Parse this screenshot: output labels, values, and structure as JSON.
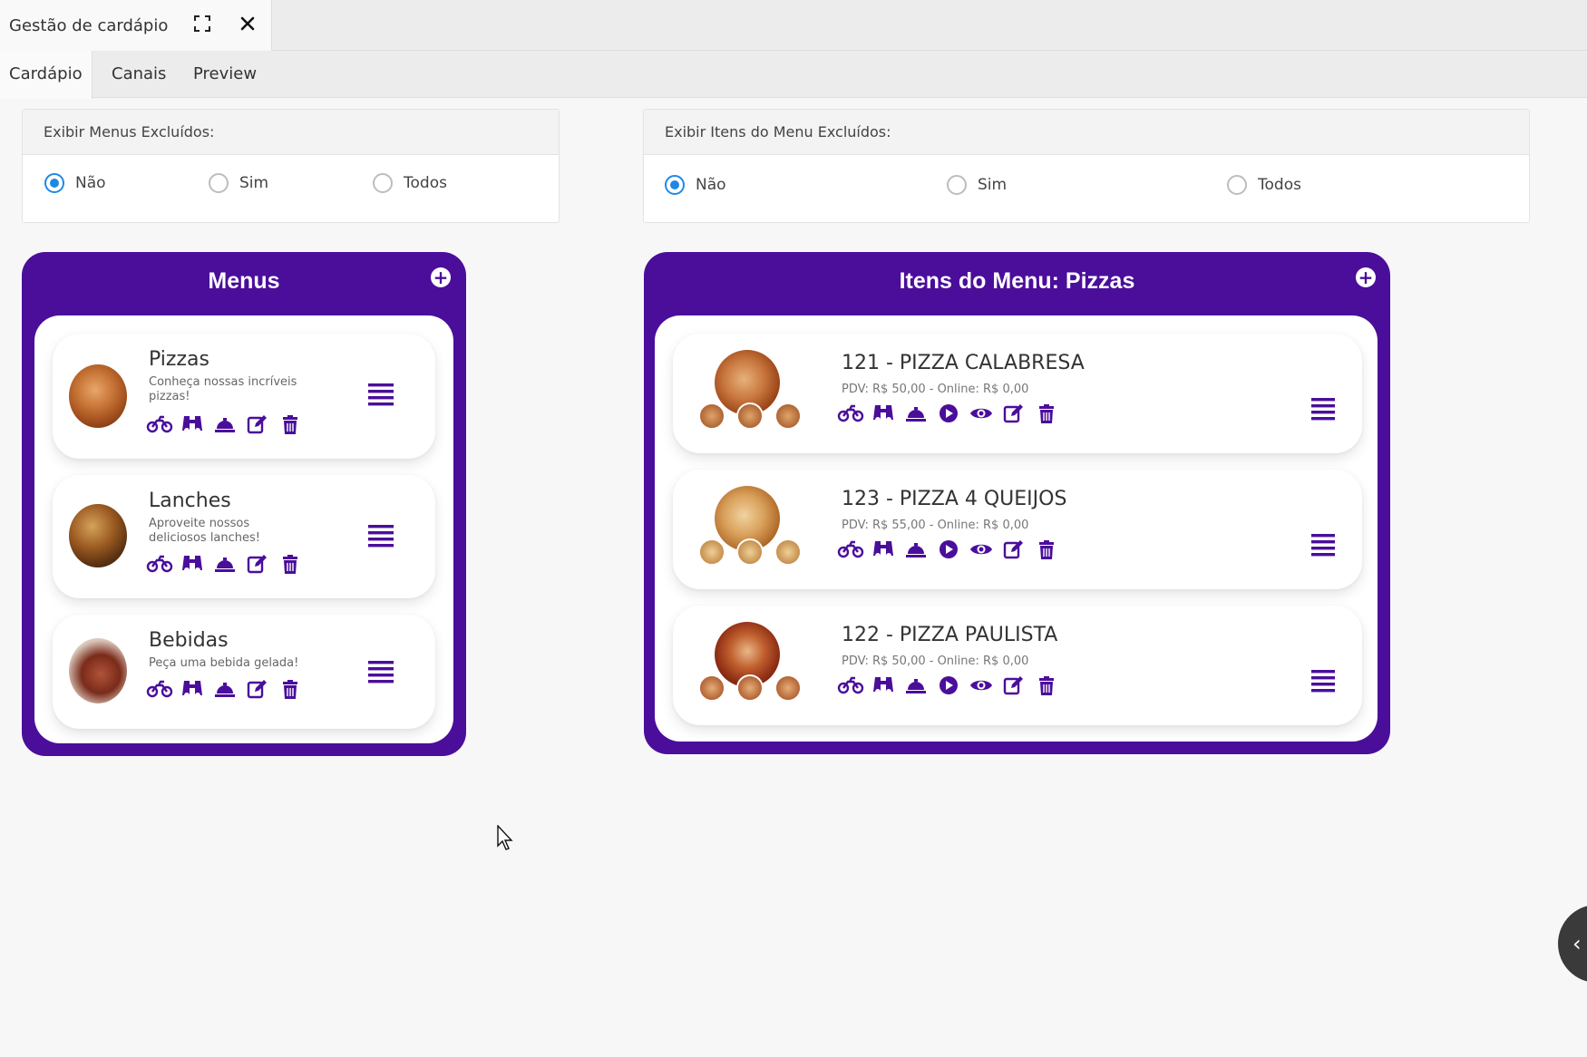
{
  "window": {
    "title": "Gestão de cardápio",
    "expand_icon": "expand-icon",
    "close_icon": "close-icon"
  },
  "tabs": [
    {
      "label": "Cardápio",
      "active": true
    },
    {
      "label": "Canais",
      "active": false
    },
    {
      "label": "Preview",
      "active": false
    }
  ],
  "filters": {
    "menus": {
      "header": "Exibir Menus Excluídos:",
      "options": [
        {
          "label": "Não",
          "selected": true
        },
        {
          "label": "Sim",
          "selected": false
        },
        {
          "label": "Todos",
          "selected": false
        }
      ]
    },
    "items": {
      "header": "Exibir Itens do Menu Excluídos:",
      "options": [
        {
          "label": "Não",
          "selected": true
        },
        {
          "label": "Sim",
          "selected": false
        },
        {
          "label": "Todos",
          "selected": false
        }
      ]
    }
  },
  "menus_panel": {
    "title": "Menus",
    "add_icon": "plus-circle-icon",
    "items": [
      {
        "name": "Pizzas",
        "description": "Conheça nossas incríveis pizzas!"
      },
      {
        "name": "Lanches",
        "description": "Aproveite nossos deliciosos lanches!"
      },
      {
        "name": "Bebidas",
        "description": "Peça uma bebida gelada!"
      }
    ]
  },
  "items_panel": {
    "title": "Itens do Menu: Pizzas",
    "add_icon": "plus-circle-icon",
    "items": [
      {
        "name": "121 - PIZZA CALABRESA",
        "price": "PDV: R$ 50,00 - Online: R$ 0,00"
      },
      {
        "name": "123 - PIZZA 4 QUEIJOS",
        "price": "PDV: R$ 55,00 - Online: R$ 0,00"
      },
      {
        "name": "122 - PIZZA PAULISTA",
        "price": "PDV: R$ 50,00 - Online: R$ 0,00"
      }
    ]
  },
  "icon_names": {
    "menu_actions": [
      "motorcycle-icon",
      "binoculars-icon",
      "cloche-icon",
      "edit-icon",
      "trash-icon"
    ],
    "item_actions": [
      "motorcycle-icon",
      "binoculars-icon",
      "cloche-icon",
      "play-icon",
      "eye-icon",
      "edit-icon",
      "trash-icon"
    ],
    "drag_handle": "hamburger-icon",
    "side_toggle": "chevron-left-icon"
  },
  "colors": {
    "brand_purple": "#4a0e9b",
    "radio_selected": "#1e88e5"
  }
}
